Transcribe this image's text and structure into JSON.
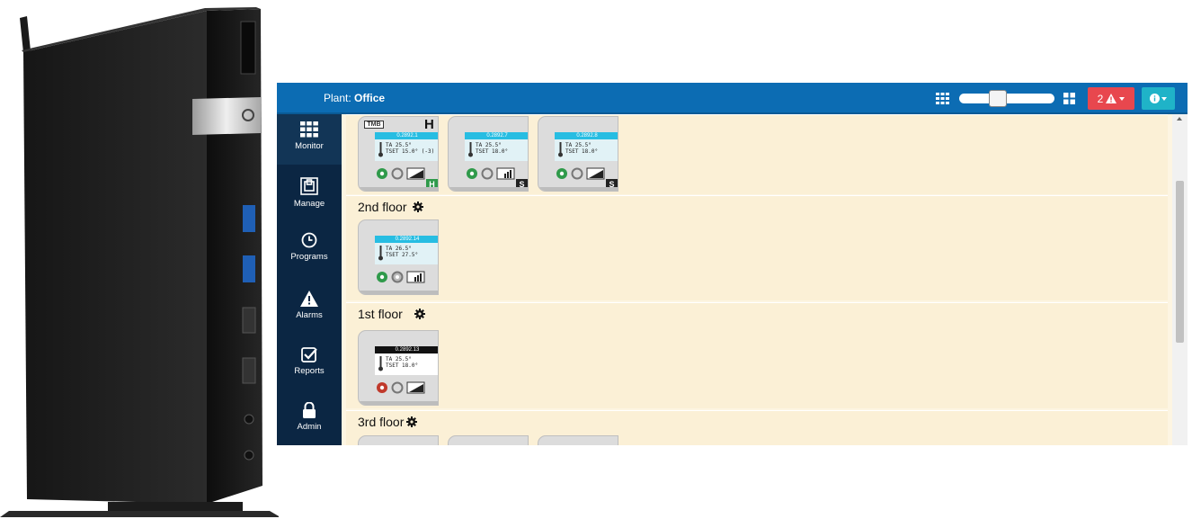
{
  "colors": {
    "topbar": "#0c6cb3",
    "sidebar": "#0b2643",
    "content_bg": "#fdf5e2",
    "alarm": "#e8474e",
    "info": "#1fb3c8",
    "lcd_header": "#27bde2"
  },
  "header": {
    "plant_label": "Plant:",
    "plant_name": "Office",
    "grid_large_icon": "grid-large-icon",
    "grid_small_icon": "grid-small-icon",
    "alarm_count": "2",
    "alarm_icon": "warning-icon",
    "info_icon": "info-icon"
  },
  "sidebar": {
    "items": [
      {
        "label": "Monitor",
        "icon": "grid-icon"
      },
      {
        "label": "Manage",
        "icon": "manage-icon"
      },
      {
        "label": "Programs",
        "icon": "clock-icon"
      },
      {
        "label": "Alarms",
        "icon": "warning-icon"
      },
      {
        "label": "Reports",
        "icon": "checkbox-icon"
      },
      {
        "label": "Admin",
        "icon": "lock-icon"
      }
    ]
  },
  "zones": [
    {
      "title": "",
      "cards": [
        {
          "tag": "TMB",
          "letter": "H",
          "header": "0.2892.1",
          "line1": "TA 25.5°",
          "line2": "TSET 15.0° (-3)",
          "badge": "H",
          "badge_color": "#2f9a4a",
          "status": "green"
        },
        {
          "tag": "",
          "letter": "",
          "header": "0.2892.7",
          "line1": "TA 25.5°",
          "line2": "TSET 18.0°",
          "badge": "S",
          "badge_color": "#222222",
          "status": "green"
        },
        {
          "tag": "",
          "letter": "",
          "header": "0.2892.8",
          "line1": "TA 25.5°",
          "line2": "TSET 18.0°",
          "badge": "S",
          "badge_color": "#222222",
          "status": "green"
        }
      ]
    },
    {
      "title": "2nd floor",
      "cards": [
        {
          "tag": "",
          "letter": "",
          "header": "0.2892.14",
          "line1": "TA 26.5°",
          "line2": "TSET 27.5°",
          "badge": "",
          "badge_color": "",
          "status": "green"
        }
      ]
    },
    {
      "title": "1st floor",
      "cards": [
        {
          "tag": "",
          "letter": "",
          "header": "0.2892.13",
          "line1": "TA 25.5°",
          "line2": "TSET 18.0°",
          "badge": "",
          "badge_color": "",
          "status": "red"
        }
      ]
    },
    {
      "title": "3rd floor",
      "cards": []
    }
  ]
}
